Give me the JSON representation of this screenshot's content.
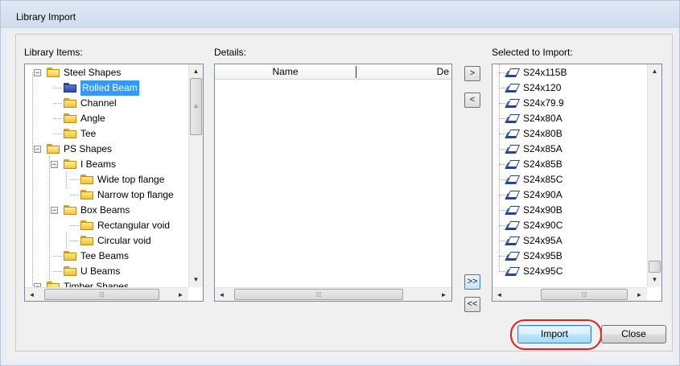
{
  "window": {
    "title": "Library Import"
  },
  "library": {
    "label": "Library Items:",
    "tree": [
      {
        "label": "Steel Shapes",
        "expander": "−",
        "selected": false
      },
      {
        "label": "Rolled Beam",
        "expander": "",
        "selected": true
      },
      {
        "label": "Channel",
        "expander": "",
        "selected": false
      },
      {
        "label": "Angle",
        "expander": "",
        "selected": false
      },
      {
        "label": "Tee",
        "expander": "",
        "selected": false
      },
      {
        "label": "PS Shapes",
        "expander": "−",
        "selected": false
      },
      {
        "label": "I Beams",
        "expander": "−",
        "selected": false
      },
      {
        "label": "Wide top flange",
        "expander": "",
        "selected": false
      },
      {
        "label": "Narrow top flange",
        "expander": "",
        "selected": false
      },
      {
        "label": "Box Beams",
        "expander": "−",
        "selected": false
      },
      {
        "label": "Rectangular void",
        "expander": "",
        "selected": false
      },
      {
        "label": "Circular void",
        "expander": "",
        "selected": false
      },
      {
        "label": "Tee Beams",
        "expander": "",
        "selected": false
      },
      {
        "label": "U Beams",
        "expander": "",
        "selected": false
      },
      {
        "label": "Timber Shapes",
        "expander": "−",
        "selected": false
      }
    ]
  },
  "details": {
    "label": "Details:",
    "columns": [
      "Name",
      "De"
    ]
  },
  "transfer": {
    "add": ">",
    "remove": "<",
    "add_all": ">>",
    "remove_all": "<<"
  },
  "selected": {
    "label": "Selected to Import:",
    "items": [
      "S24x115B",
      "S24x120",
      "S24x79.9",
      "S24x80A",
      "S24x80B",
      "S24x85A",
      "S24x85B",
      "S24x85C",
      "S24x90A",
      "S24x90B",
      "S24x90C",
      "S24x95A",
      "S24x95B",
      "S24x95C"
    ]
  },
  "scroll": {
    "up": "▲",
    "down": "▼",
    "left": "◄",
    "right": "►",
    "grip_h": "⁞⁞⁞",
    "grip_v": "≡"
  },
  "buttons": {
    "import": "Import",
    "close": "Close"
  },
  "colors": {
    "highlight": "#e02020",
    "selection": "#3399ff"
  }
}
